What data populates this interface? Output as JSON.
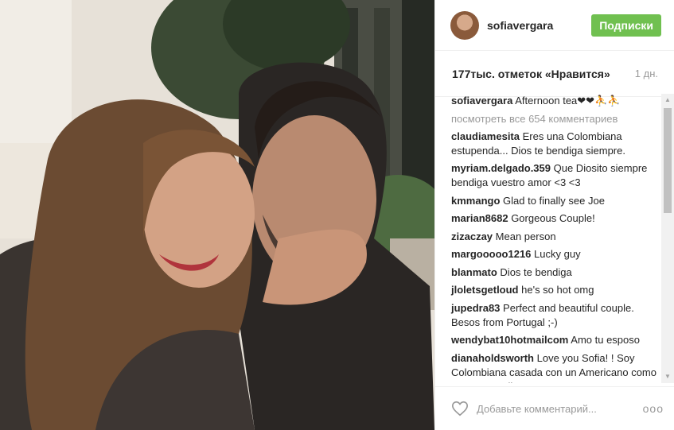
{
  "header": {
    "username": "sofiavergara",
    "follow_label": "Подписки"
  },
  "meta": {
    "likes": "177тыс. отметок «Нравится»",
    "time": "1 дн."
  },
  "caption": {
    "user": "sofiavergara",
    "text": "Afternoon tea❤❤⛹⛹"
  },
  "view_all": "посмотреть все 654 комментариев",
  "comments": [
    {
      "user": "claudiamesita",
      "text": "Eres una Colombiana estupenda... Dios te bendiga siempre."
    },
    {
      "user": "myriam.delgado.359",
      "text": "Que Diosito siempre bendiga vuestro amor <3 <3"
    },
    {
      "user": "kmmango",
      "text": "Glad to finally see Joe"
    },
    {
      "user": "marian8682",
      "text": "Gorgeous Couple!"
    },
    {
      "user": "zizaczay",
      "text": "Mean person"
    },
    {
      "user": "margooooo1216",
      "text": "Lucky guy"
    },
    {
      "user": "blanmato",
      "text": "Dios te bendiga"
    },
    {
      "user": "jloletsgetloud",
      "text": "he's so hot omg"
    },
    {
      "user": "jupedra83",
      "text": "Perfect and beautiful couple. Besos from Portugal ;-)"
    },
    {
      "user": "wendybat10hotmailcom",
      "text": "Amo tu esposo"
    },
    {
      "user": "dianaholdsworth",
      "text": "Love you Sofia! ! Soy Colombiana casada con un Americano como tu, y muy Feliz! !!"
    }
  ],
  "footer": {
    "add_comment_placeholder": "Добавьте комментарий...",
    "more_label": "ooo"
  },
  "icons": {
    "like": "heart-icon",
    "more": "more-options-icon"
  },
  "colors": {
    "follow_button": "#70c050",
    "muted_text": "#999999"
  }
}
